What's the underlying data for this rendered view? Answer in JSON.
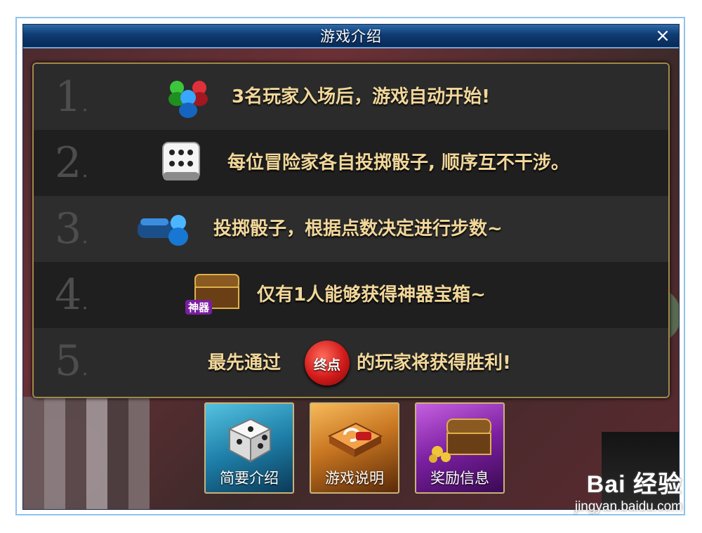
{
  "window": {
    "title": "游戏介绍",
    "close_label": "×"
  },
  "rules": [
    {
      "number": "1",
      "text": "3名玩家入场后，游戏自动开始!",
      "icon": "player-pawns-icon"
    },
    {
      "number": "2",
      "text": "每位冒险家各自投掷骰子, 顺序互不干涉。",
      "icon": "dice-icon"
    },
    {
      "number": "3",
      "text": "投掷骰子，根据点数决定进行步数~",
      "icon": "pawn-moving-icon"
    },
    {
      "number": "4",
      "text": "仅有1人能够获得神器宝箱~",
      "icon": "artifact-chest-icon",
      "icon_badge": "神器"
    },
    {
      "number": "5",
      "text_before": "最先通过",
      "badge": "终点",
      "text_after": "的玩家将获得胜利!",
      "icon": "finish-badge-icon"
    }
  ],
  "buttons": [
    {
      "label": "简要介绍",
      "icon": "dice-icon"
    },
    {
      "label": "游戏说明",
      "icon": "arrow-board-icon"
    },
    {
      "label": "奖励信息",
      "icon": "treasure-chest-icon"
    }
  ],
  "watermark": {
    "logo": "Bai 经验",
    "url": "jingyan.baidu.com"
  },
  "colors": {
    "title_bar": "#0e3b72",
    "rule_text": "#f1d79a",
    "panel_border": "#a08a4a",
    "finish_badge": "#d21a1a"
  }
}
